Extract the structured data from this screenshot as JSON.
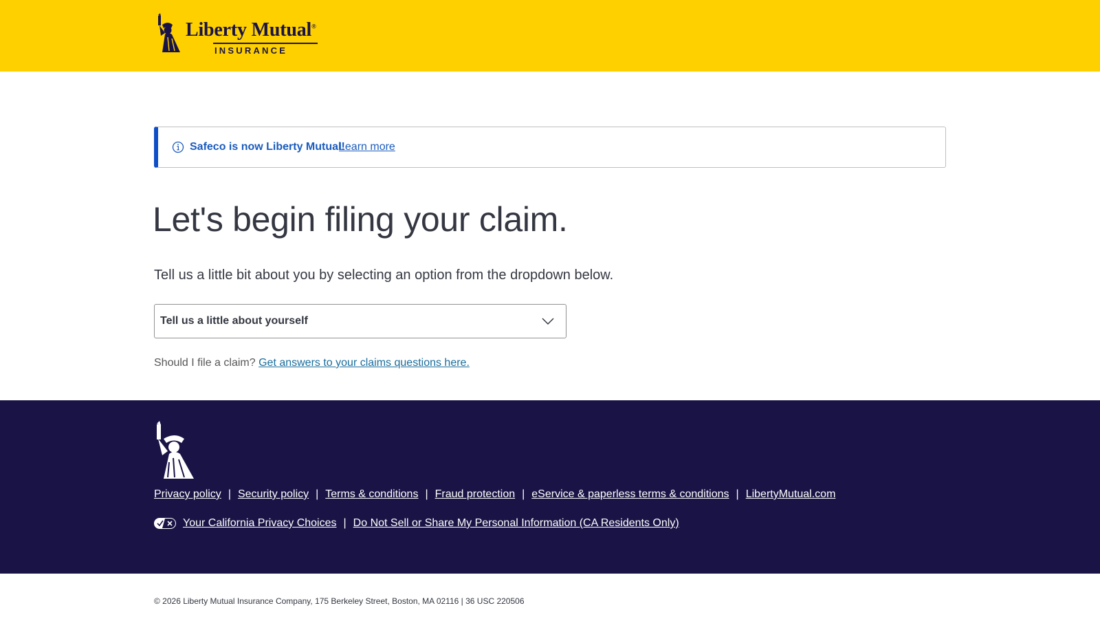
{
  "header": {
    "logo_name": "Liberty Mutual",
    "logo_sub": "INSURANCE",
    "background": "#ffd000"
  },
  "alert": {
    "icon": "info-circle-icon",
    "message": "Safeco is now Liberty Mutual!",
    "link_label": "Learn more",
    "accent": "#0d4fc9"
  },
  "main": {
    "title": "Let's begin filing your claim.",
    "intro": "Tell us a little bit about you by selecting an option from the dropdown below.",
    "dropdown": {
      "selected": "Tell us a little about yourself",
      "icon": "chevron-down-icon"
    },
    "helper_text": "Should I file a claim?",
    "helper_link": "Get answers to your claims questions here."
  },
  "footer": {
    "background": "#1a1446",
    "links": [
      "Privacy policy",
      "Security policy",
      "Terms & conditions",
      "Fraud protection",
      "eService & paperless terms & conditions",
      "LibertyMutual.com"
    ],
    "privacy_icon": "privacy-choices-toggle-icon",
    "privacy_links": [
      "Your California Privacy Choices",
      "Do Not Sell or Share My Personal Information (CA Residents Only)"
    ],
    "separator": "|"
  },
  "copyright": "© 2026 Liberty Mutual Insurance Company, 175 Berkeley Street, Boston, MA 02116 | 36 USC 220506"
}
